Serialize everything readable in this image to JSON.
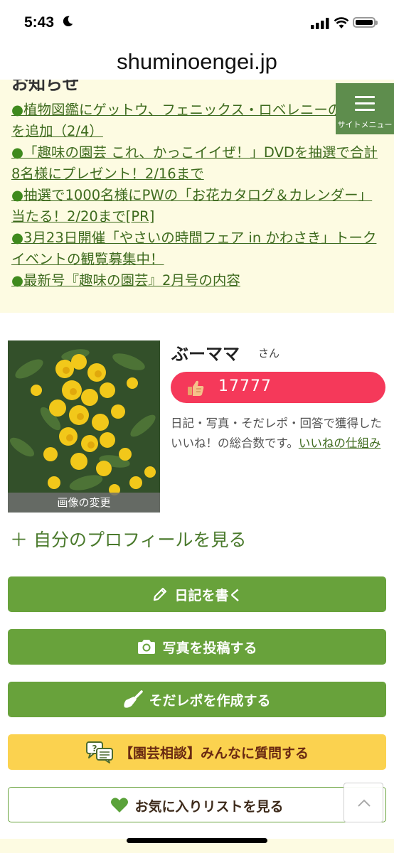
{
  "status_bar": {
    "time": "5:43"
  },
  "browser": {
    "url": "shuminoengei.jp"
  },
  "news": {
    "heading": "お知らせ",
    "items": [
      {
        "bullet": "●",
        "text": "植物図鑑にゲットウ、フェニックス・ロベレニーの情報を追加（2/4）"
      },
      {
        "bullet": "●",
        "text": "「趣味の園芸 これ、かっこイイぜ！」DVDを抽選で合計8名様にプレゼント！2/16まで"
      },
      {
        "bullet": "●",
        "text": "抽選で1000名様にPWの「お花カタログ＆カレンダー」当たる！2/20まで[PR]"
      },
      {
        "bullet": "●",
        "text": "3月23日開催「やさいの時間フェア in かわさき」トークイベントの観覧募集中！"
      },
      {
        "bullet": "●",
        "text": "最新号『趣味の園芸』2月号の内容"
      }
    ]
  },
  "site_menu": {
    "label": "サイトメニュー"
  },
  "profile": {
    "photo_caption": "画像の変更",
    "name": "ぶーママ",
    "honorific": "さん",
    "likes_count": "17777",
    "likes_desc": "日記・写真・そだレポ・回答で獲得したいいね！の総合数です。",
    "likes_link": "いいねの仕組み",
    "view_profile": "＋ 自分のプロフィールを見る"
  },
  "actions": {
    "diary": "日記を書く",
    "photo": "写真を投稿する",
    "sodarepo": "そだレポを作成する",
    "consult": "【園芸相談】みんなに質問する",
    "favorites": "お気に入りリストを見る"
  },
  "colors": {
    "green": "#68a23b",
    "yellow": "#fbd24f",
    "pink": "#f5395a",
    "news_bg": "#fdfbe2",
    "link": "#3e6b1e"
  }
}
